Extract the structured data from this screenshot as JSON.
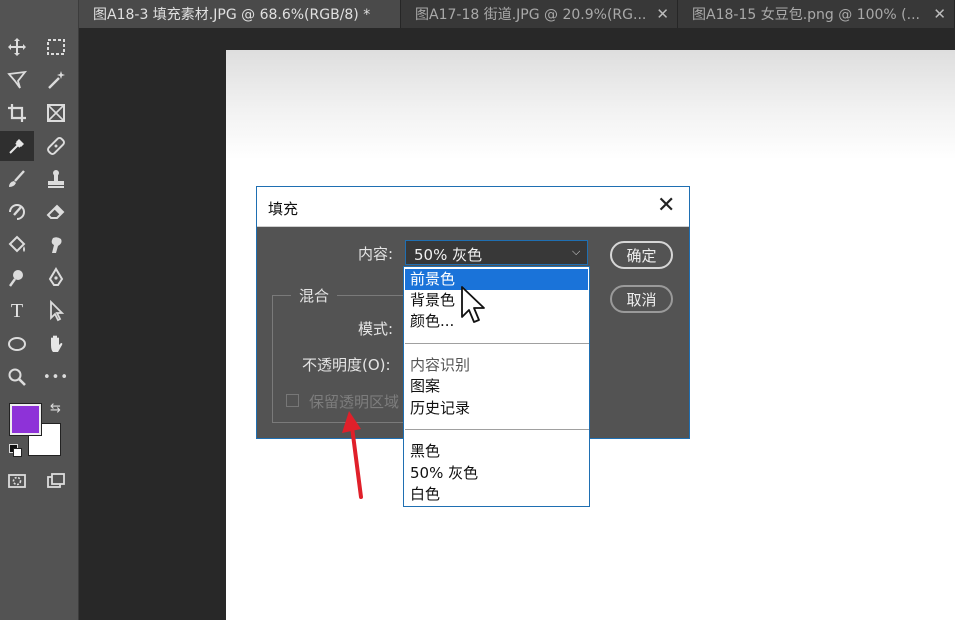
{
  "tabs": [
    {
      "label": "图A18-3 填充素材.JPG @ 68.6%(RGB/8) *",
      "close": "✕",
      "active": true
    },
    {
      "label": "图A17-18 街道.JPG @ 20.9%(RG...",
      "close": "✕",
      "active": false
    },
    {
      "label": "图A18-15 女豆包.png @ 100% (...",
      "close": "✕",
      "active": false
    }
  ],
  "toolbar": {
    "type_tool": "T",
    "more_tools": "•••",
    "foreground_color": "#8e32d8",
    "background_color": "#ffffff"
  },
  "dialog": {
    "title": "填充",
    "close": "✕",
    "content_label": "内容:",
    "content_value": "50% 灰色",
    "ok": "确定",
    "cancel": "取消",
    "blend_legend": "混合",
    "mode_label": "模式:",
    "opacity_label": "不透明度(O):",
    "preserve_label": "保留透明区域"
  },
  "dropdown": {
    "group1": [
      "前景色",
      "背景色",
      "颜色..."
    ],
    "group2": [
      "内容识别",
      "图案",
      "历史记录"
    ],
    "group3": [
      "黑色",
      "50% 灰色",
      "白色"
    ]
  },
  "colors": {
    "accent": "#1a73d9",
    "annotation_arrow": "#e0202a"
  }
}
